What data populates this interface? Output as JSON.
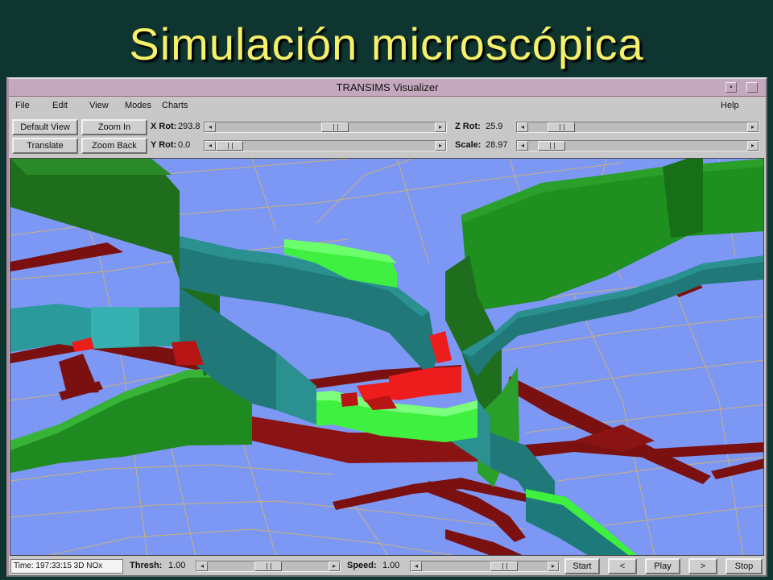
{
  "slide": {
    "title": "Simulación microscópica"
  },
  "window": {
    "title": "TRANSIMS Visualizer",
    "menu": {
      "file": "File",
      "edit": "Edit",
      "view": "View",
      "modes": "Modes",
      "charts": "Charts",
      "help": "Help"
    }
  },
  "controls": {
    "default_view": "Default View",
    "zoom_in": "Zoom In",
    "translate": "Translate",
    "zoom_back": "Zoom Back",
    "x_rot": {
      "label": "X Rot:",
      "value": "293.8",
      "level": 0.55
    },
    "y_rot": {
      "label": "Y Rot:",
      "value": "0.0",
      "level": 0.0
    },
    "z_rot": {
      "label": "Z Rot:",
      "value": "25.9",
      "level": 0.1
    },
    "scale": {
      "label": "Scale:",
      "value": "28.97",
      "level": 0.05
    }
  },
  "status": {
    "time": "Time: 197:33:15 3D NOx",
    "thresh": {
      "label": "Thresh:",
      "value": "1.00",
      "level": 0.5
    },
    "speed": {
      "label": "Speed:",
      "value": "1.00",
      "level": 0.7
    },
    "start": "Start",
    "prev": "<",
    "play": "Play",
    "next": ">",
    "stop": "Stop"
  },
  "colors": {
    "ground": "#7d97f5",
    "road_grid": "#c8b27a",
    "dark_green": "#1a7a1a",
    "green": "#2aa02a",
    "light_green": "#40f040",
    "teal": "#1e7a7a",
    "red": "#ee1d1d",
    "dark_red": "#7a1010"
  },
  "icons": {
    "window_menu": "window-menu-icon",
    "slider_left": "arrow-left-icon",
    "slider_right": "arrow-right-icon"
  }
}
